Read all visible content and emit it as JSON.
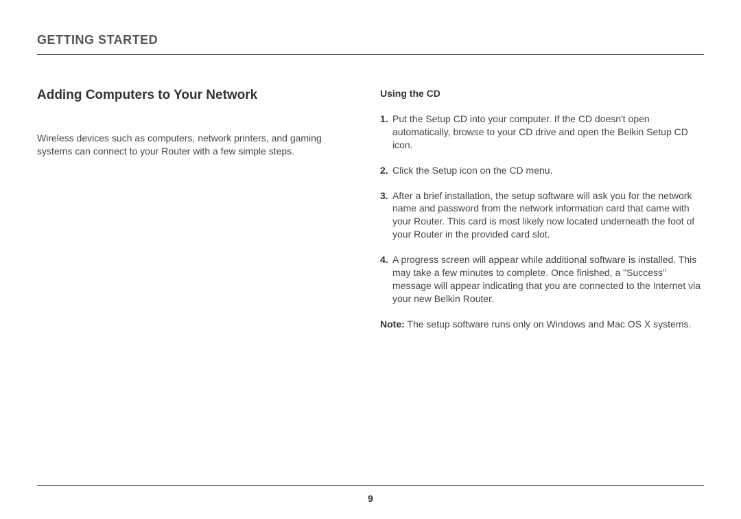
{
  "chapter_title": "GETTING STARTED",
  "section_title": "Adding Computers to Your Network",
  "intro_text": "Wireless devices such as computers, network printers, and gaming systems can connect to your Router with a few simple steps.",
  "sub_title": "Using the CD",
  "steps": [
    {
      "num": "1.",
      "text": "Put the Setup CD into your computer. If the CD doesn't open automatically, browse to your CD drive and open the Belkin Setup CD icon."
    },
    {
      "num": "2.",
      "text": "Click the Setup icon on the CD menu."
    },
    {
      "num": "3.",
      "text": "After a brief installation, the setup software will ask you for the network name and password from the network information card that came with your Router. This card is most likely now located underneath the foot of your Router in the provided card slot."
    },
    {
      "num": "4.",
      "text": "A progress screen will appear while additional software is installed. This may take a few minutes to complete. Once finished, a \"Success\" message will appear indicating that you are connected to the Internet via your new Belkin Router."
    }
  ],
  "note_label": "Note:",
  "note_text": " The setup software runs only on Windows and Mac OS X systems.",
  "page_number": "9"
}
